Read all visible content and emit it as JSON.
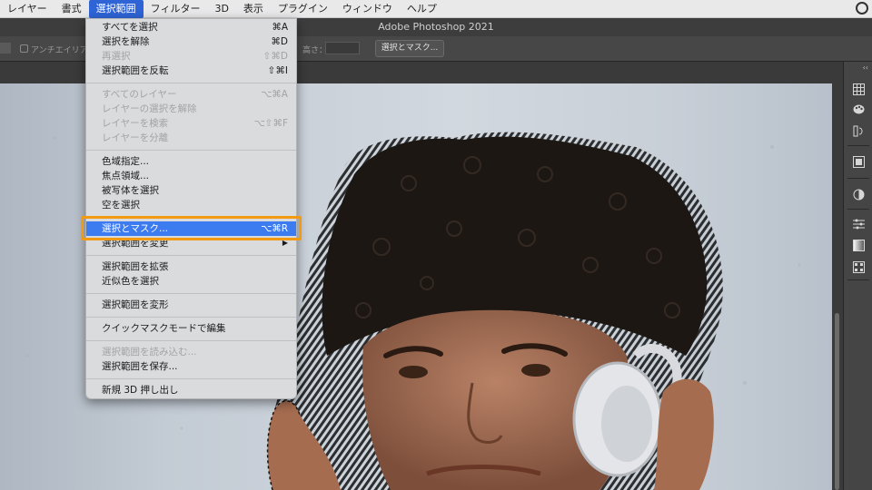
{
  "menubar": {
    "items": [
      "レイヤー",
      "書式",
      "選択範囲",
      "フィルター",
      "3D",
      "表示",
      "プラグイン",
      "ウィンドウ",
      "ヘルプ"
    ],
    "active_index": 2
  },
  "window": {
    "title": "Adobe Photoshop 2021"
  },
  "options_bar": {
    "antialias_label": "アンチエイリアス",
    "height_label": "高さ：",
    "select_mask_button": "選択とマスク..."
  },
  "dropdown": {
    "items": [
      {
        "label": "すべてを選択",
        "shortcut": "⌘A",
        "disabled": false
      },
      {
        "label": "選択を解除",
        "shortcut": "⌘D",
        "disabled": false
      },
      {
        "label": "再選択",
        "shortcut": "⇧⌘D",
        "disabled": true
      },
      {
        "label": "選択範囲を反転",
        "shortcut": "⇧⌘I",
        "disabled": false
      },
      {
        "label": "すべてのレイヤー",
        "shortcut": "⌥⌘A",
        "disabled": true
      },
      {
        "label": "レイヤーの選択を解除",
        "shortcut": "",
        "disabled": true
      },
      {
        "label": "レイヤーを検索",
        "shortcut": "⌥⇧⌘F",
        "disabled": true
      },
      {
        "label": "レイヤーを分離",
        "shortcut": "",
        "disabled": true
      },
      {
        "label": "色域指定...",
        "shortcut": "",
        "disabled": false
      },
      {
        "label": "焦点領域...",
        "shortcut": "",
        "disabled": false
      },
      {
        "label": "被写体を選択",
        "shortcut": "",
        "disabled": false
      },
      {
        "label": "空を選択",
        "shortcut": "",
        "disabled": false
      },
      {
        "label": "選択とマスク...",
        "shortcut": "⌥⌘R",
        "disabled": false,
        "highlighted": true
      },
      {
        "label": "選択範囲を変更",
        "shortcut": "▶",
        "disabled": false
      },
      {
        "label": "選択範囲を拡張",
        "shortcut": "",
        "disabled": false
      },
      {
        "label": "近似色を選択",
        "shortcut": "",
        "disabled": false
      },
      {
        "label": "選択範囲を変形",
        "shortcut": "",
        "disabled": false
      },
      {
        "label": "クイックマスクモードで編集",
        "shortcut": "",
        "disabled": false
      },
      {
        "label": "選択範囲を読み込む...",
        "shortcut": "",
        "disabled": true
      },
      {
        "label": "選択範囲を保存...",
        "shortcut": "",
        "disabled": false
      },
      {
        "label": "新規 3D 押し出し",
        "shortcut": "",
        "disabled": false
      }
    ]
  },
  "right_panel": {
    "icons": [
      "grid-icon",
      "palette-icon",
      "history-icon",
      "navigator-icon",
      "adjustments-icon",
      "properties-icon",
      "gradient-icon",
      "swatches-icon"
    ]
  },
  "colors": {
    "menu_highlight": "#3c7bf0",
    "callout": "#f39a13",
    "active_menu": "#2e64d6"
  }
}
